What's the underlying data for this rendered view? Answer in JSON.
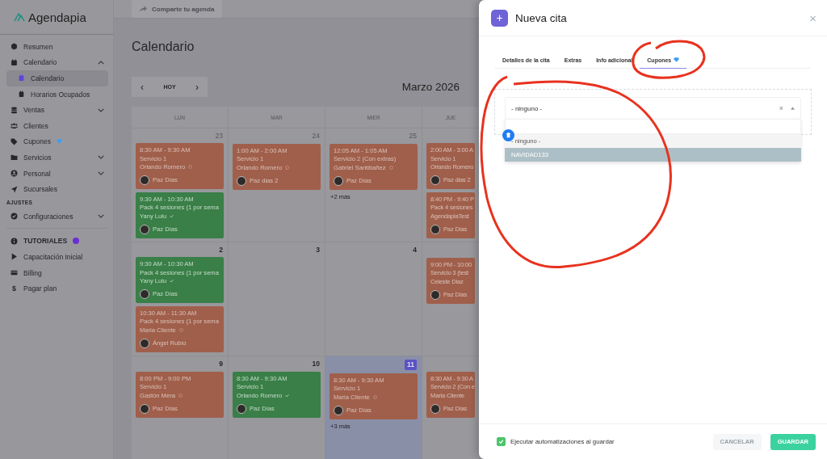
{
  "sidebar": {
    "logo": "Agendapia",
    "items": [
      {
        "kind": "link",
        "label": "Resumen",
        "premium": false
      },
      {
        "kind": "group",
        "label": "Calendario",
        "expanded": true,
        "premium": false,
        "children": [
          {
            "label": "Calendario",
            "selected": true
          },
          {
            "label": "Horarios Ocupados",
            "selected": false
          }
        ]
      },
      {
        "kind": "group",
        "label": "Ventas",
        "expanded": false,
        "premium": false
      },
      {
        "kind": "link",
        "label": "Clientes",
        "premium": false
      },
      {
        "kind": "link",
        "label": "Cupones",
        "premium": true
      },
      {
        "kind": "group",
        "label": "Servicios",
        "expanded": false,
        "premium": false
      },
      {
        "kind": "group",
        "label": "Personal",
        "expanded": false,
        "premium": false
      },
      {
        "kind": "link",
        "label": "Sucursales",
        "premium": false
      },
      {
        "kind": "heading",
        "label": "AJUSTES"
      },
      {
        "kind": "group",
        "label": "Configuraciones",
        "expanded": false,
        "premium": false
      },
      {
        "kind": "divider"
      },
      {
        "kind": "tutorials",
        "label": "TUTORIALES",
        "premium": false
      },
      {
        "kind": "link",
        "label": "Capacitación Inicial",
        "premium": false
      },
      {
        "kind": "link",
        "label": "Billing",
        "premium": false
      },
      {
        "kind": "text-icon",
        "label": "Pagar plan",
        "icon_text": "$",
        "premium": false
      }
    ]
  },
  "topbar": {
    "share_button": "Comparte tu agenda"
  },
  "page_title": "Calendario",
  "calendar": {
    "today_button": "HOY",
    "prev": "‹",
    "next": "›",
    "month": "Marzo 2026",
    "weekdays": [
      "LUN",
      "MAR",
      "MIER",
      "JUE"
    ],
    "weeks": [
      {
        "days": [
          {
            "number": "23",
            "other_month": true,
            "events": [
              {
                "time": "8:30 AM - 9:30 AM",
                "service": "Servicio 1",
                "client": "Orlando Romero",
                "confirmed": false,
                "staff": "Paz Días"
              },
              {
                "time": "9:30 AM - 10:30 AM",
                "service": "Pack 4 sesiones (1 por sema",
                "client": "Yany Lulu",
                "confirmed": true,
                "staff": "Paz Días"
              }
            ]
          },
          {
            "number": "24",
            "other_month": true,
            "events": [
              {
                "time": "1:00 AM - 2:00 AM",
                "service": "Servicio 1",
                "client": "Orlando Romero",
                "confirmed": false,
                "staff": "Paz dias 2"
              }
            ]
          },
          {
            "number": "25",
            "other_month": true,
            "events": [
              {
                "time": "12:05 AM - 1:05 AM",
                "service": "Servicio 2 (Con extras)",
                "client": "Gabriel Santibañez",
                "confirmed": false,
                "staff": "Paz Días"
              }
            ],
            "more": "+2 más"
          },
          {
            "events": [
              {
                "time": "2:00 AM - 3:00 A",
                "service": "Servicio 1",
                "client": "Orlando Romero",
                "confirmed": false,
                "staff": "Paz dias 2"
              },
              {
                "time": "8:40 PM - 9:40 P",
                "service": "Pack 4 sesiones",
                "client": "AgendapiaTest",
                "confirmed": false,
                "staff": "Paz Días"
              }
            ]
          }
        ]
      },
      {
        "days": [
          {
            "number": "2",
            "other_month": false,
            "events": [
              {
                "time": "9:30 AM - 10:30 AM",
                "service": "Pack 4 sesiones (1 por sema",
                "client": "Yany Lulu",
                "confirmed": true,
                "staff": "Paz Días"
              },
              {
                "time": "10:30 AM - 11:30 AM",
                "service": "Pack 4 sesiones (1 por sema",
                "client": "Maria Cliente",
                "confirmed": false,
                "staff": "Ángel Rubio"
              }
            ]
          },
          {
            "number": "3",
            "other_month": false
          },
          {
            "number": "4",
            "other_month": false
          },
          {
            "events": [
              {
                "time": "9:00 PM - 10:00",
                "service": "Servicio 3 (test",
                "client": "Celeste Diaz",
                "confirmed": false,
                "staff": "Paz Días"
              }
            ]
          }
        ]
      },
      {
        "days": [
          {
            "number": "9",
            "other_month": false,
            "today": false,
            "events": [
              {
                "time": "8:00 PM - 9:00 PM",
                "service": "Servicio 1",
                "client": "Gastón Mera",
                "confirmed": false,
                "staff": "Paz Días"
              }
            ]
          },
          {
            "number": "10",
            "other_month": false,
            "today": false,
            "events": [
              {
                "time": "8:30 AM - 9:30 AM",
                "service": "Servicio 1",
                "client": "Orlando Romero",
                "confirmed": true,
                "staff": "Paz Días"
              }
            ]
          },
          {
            "number": "11",
            "other_month": false,
            "today": true,
            "events": [
              {
                "time": "8:30 AM - 9:30 AM",
                "service": "Servicio 1",
                "client": "Maria Cliente",
                "confirmed": false,
                "staff": "Paz Días"
              }
            ],
            "more": "+3 más"
          },
          {
            "events": [
              {
                "time": "8:30 AM - 9:30 A",
                "service": "Servicio 2 (Con e",
                "client": "Maria Cliente",
                "confirmed": false,
                "staff": "Paz Días"
              }
            ]
          }
        ]
      }
    ]
  },
  "modal": {
    "title": "Nueva cita",
    "add_icon": "+",
    "close": "×",
    "tabs": [
      {
        "label": "Detalles de la cita",
        "selected": false,
        "premium": false
      },
      {
        "label": "Extras",
        "selected": false,
        "premium": false
      },
      {
        "label": "Info adicional",
        "selected": false,
        "premium": false
      },
      {
        "label": "Cupones",
        "selected": true,
        "premium": true
      }
    ],
    "coupon_select": {
      "value": "- ninguno -",
      "clear": "×",
      "open": true,
      "options": [
        {
          "label": "- ninguno -",
          "selected": true,
          "highlighted": false
        },
        {
          "label": "NAVIDAD133",
          "selected": false,
          "highlighted": true
        }
      ]
    },
    "automation": {
      "label": "Ejecutar automatizaciones al guardar",
      "checked": true
    },
    "buttons": {
      "cancel": "CANCELAR",
      "save": "GUARDAR"
    }
  }
}
